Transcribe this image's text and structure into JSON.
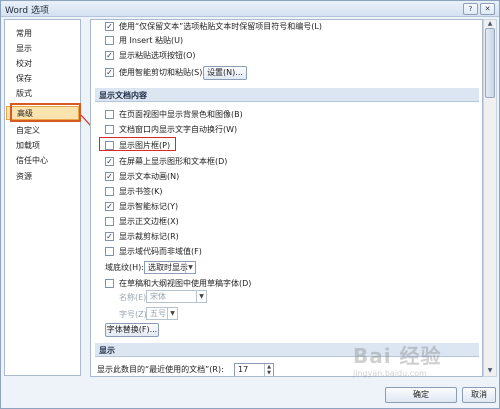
{
  "window": {
    "title": "Word 选项",
    "help_glyph": "?",
    "close_glyph": "✕"
  },
  "sidebar": {
    "items": [
      {
        "label": "常用"
      },
      {
        "label": "显示"
      },
      {
        "label": "校对"
      },
      {
        "label": "保存"
      },
      {
        "label": "版式"
      },
      {
        "label": "高级"
      },
      {
        "label": "自定义"
      },
      {
        "label": "加载项"
      },
      {
        "label": "信任中心"
      },
      {
        "label": "资源"
      }
    ],
    "selected": "高级"
  },
  "top_options": [
    {
      "label": "使用“仅保留文本”选项粘贴文本时保留项目符号和编号(L)",
      "checked": true
    },
    {
      "label": "用 Insert 粘贴(U)",
      "checked": false
    },
    {
      "label": "显示粘贴选项按钮(O)",
      "checked": true
    },
    {
      "label": "使用智能剪切和粘贴(S)",
      "checked": true
    }
  ],
  "settings_button": "设置(N)...",
  "section_document_content": {
    "title": "显示文档内容",
    "options": [
      {
        "label": "在页面视图中显示背景色和图像(B)",
        "checked": false
      },
      {
        "label": "文档窗口内显示文字自动换行(W)",
        "checked": false
      },
      {
        "label": "显示图片框(P)",
        "checked": false
      },
      {
        "label": "在屏幕上显示图形和文本框(D)",
        "checked": true
      },
      {
        "label": "显示文本动画(N)",
        "checked": true
      },
      {
        "label": "显示书签(K)",
        "checked": false
      },
      {
        "label": "显示智能标记(Y)",
        "checked": true
      },
      {
        "label": "显示正文边框(X)",
        "checked": false
      },
      {
        "label": "显示裁剪标记(R)",
        "checked": true
      },
      {
        "label": "显示域代码而非域值(F)",
        "checked": false
      }
    ],
    "field_shading_label": "域底纹(H):",
    "field_shading_value": "选取时显示",
    "draft_font_label": "在草稿和大纲视图中使用草稿字体(D)",
    "draft_font_checked": false,
    "name_label": "名称(E):",
    "name_value": "宋体",
    "size_label": "字号(Z):",
    "size_value": "五号",
    "font_sub_button": "字体替换(F)..."
  },
  "section_display": {
    "title": "显示",
    "recent_docs_label": "显示此数目的“最近使用的文档”(R):",
    "recent_docs_value": "17"
  },
  "footer": {
    "ok": "确定",
    "cancel": "取消"
  }
}
